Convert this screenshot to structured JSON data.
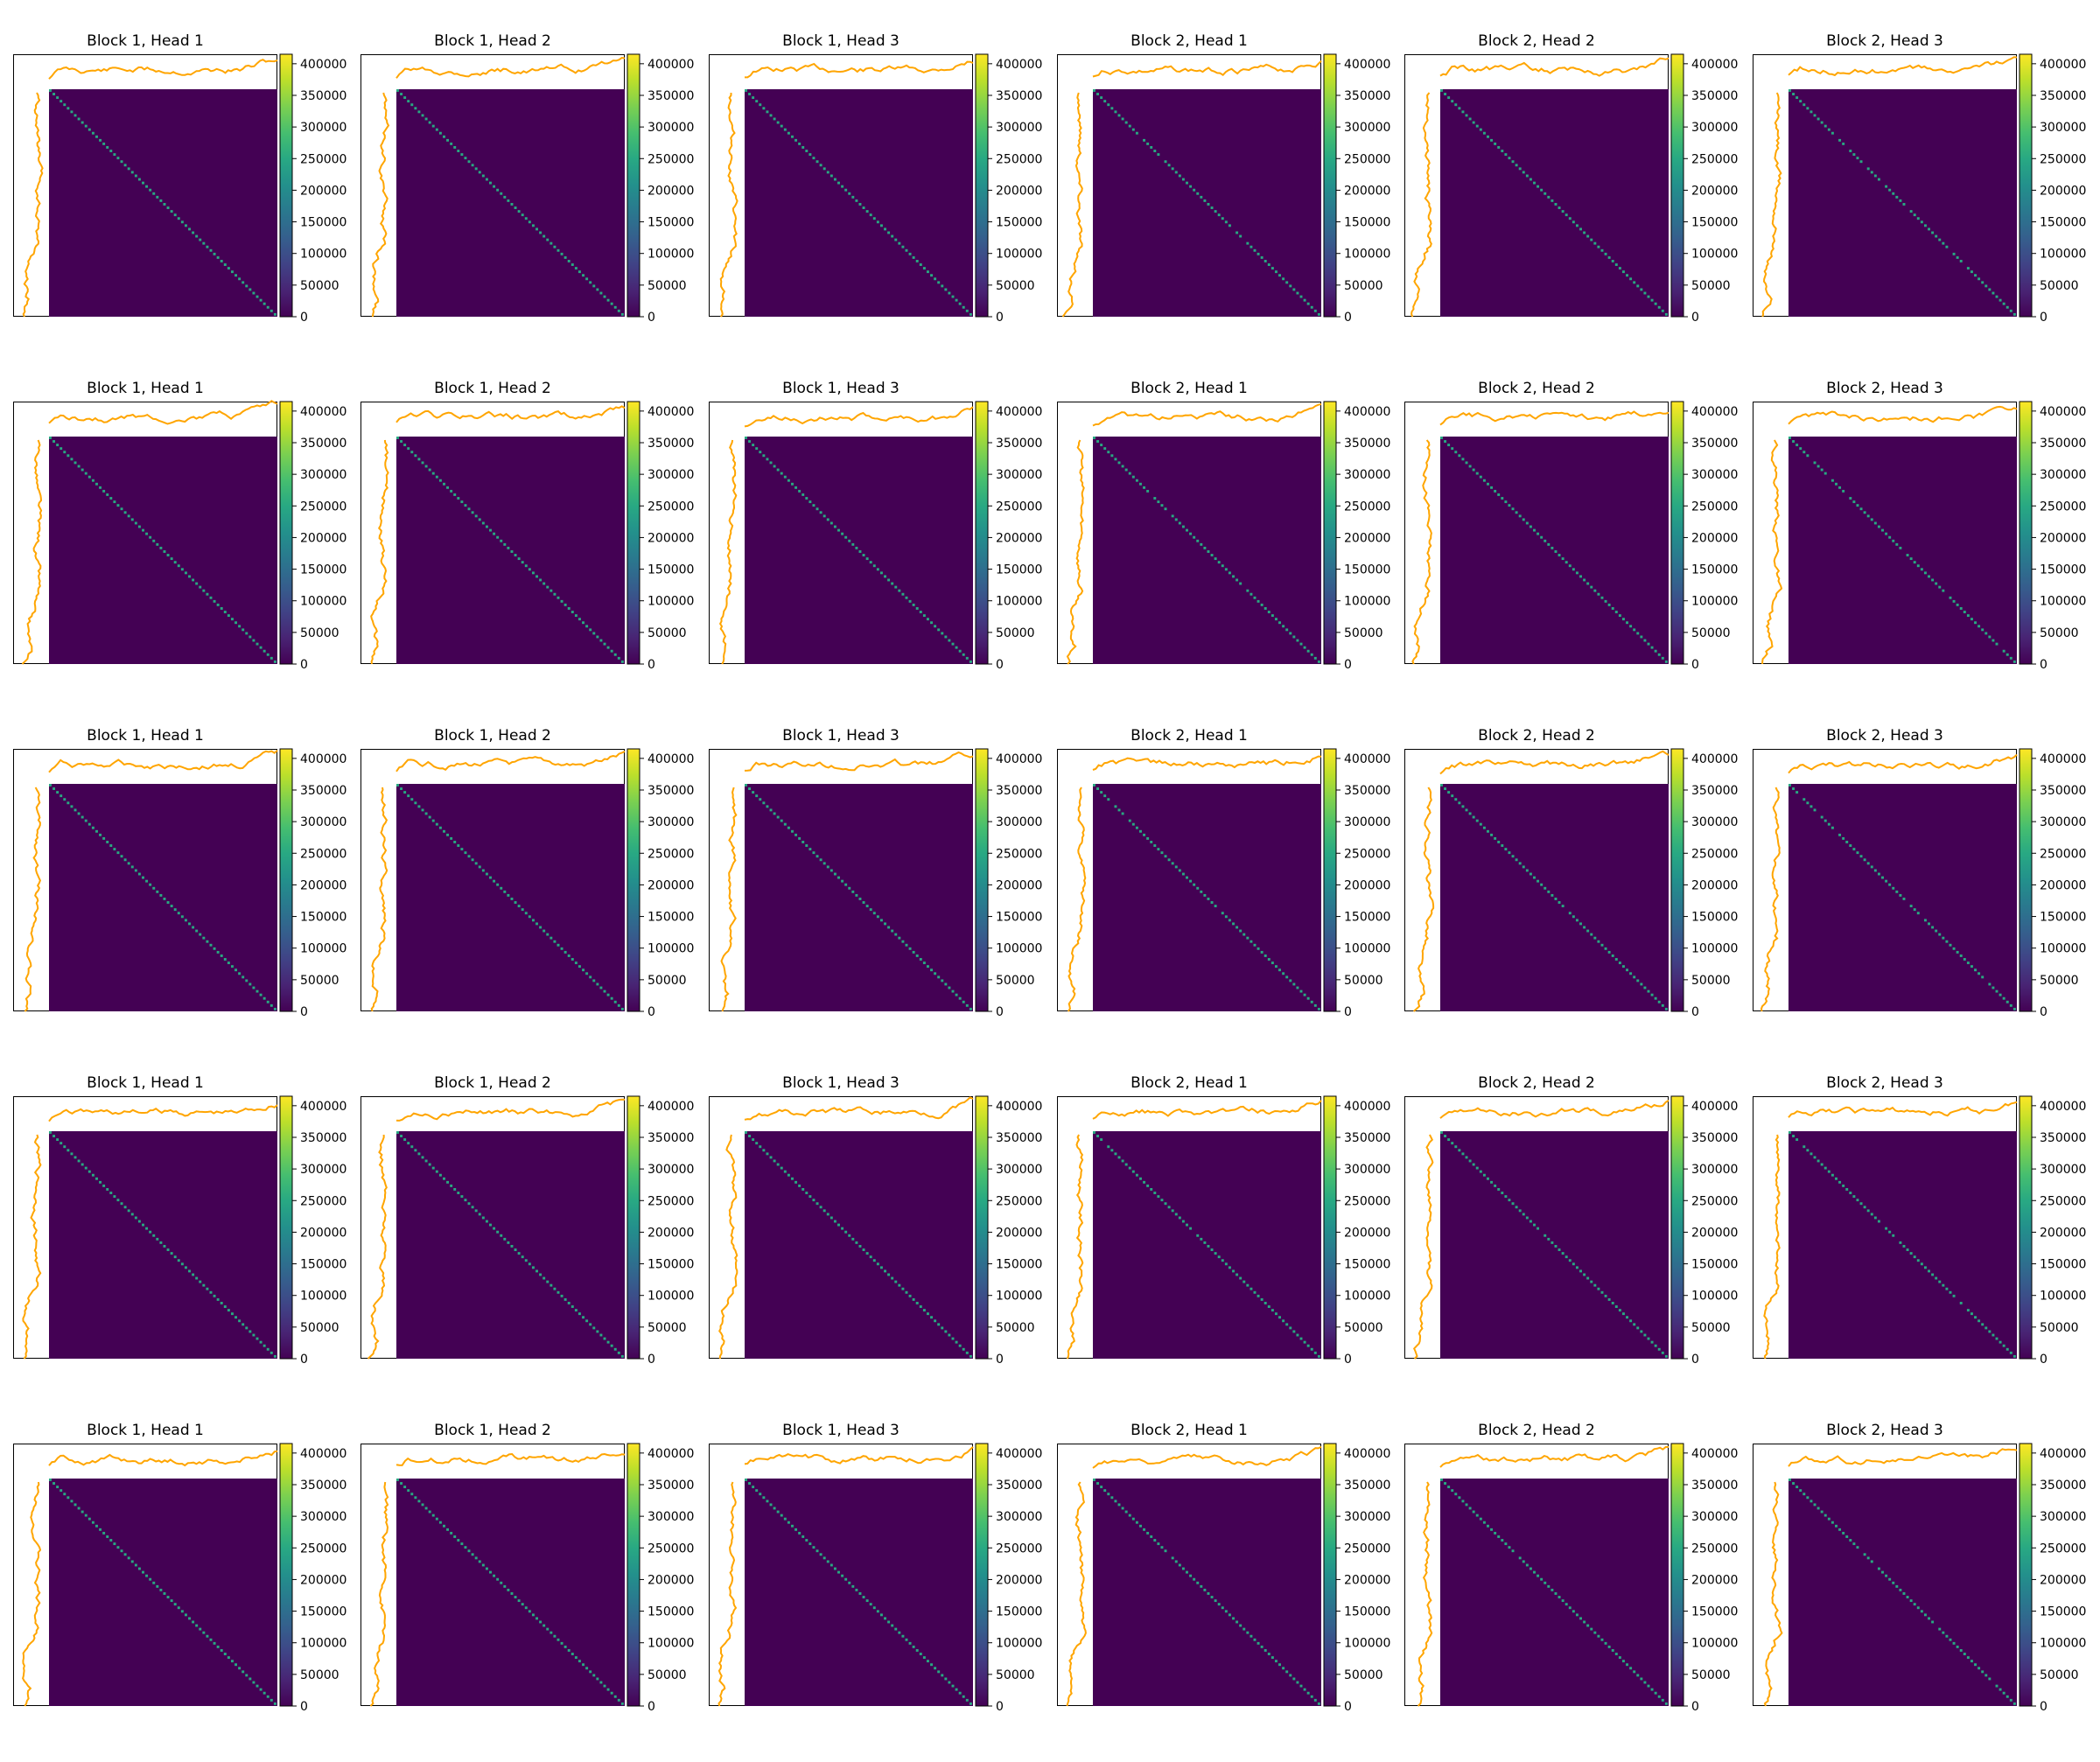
{
  "chart_data": {
    "type": "heatmap",
    "layout": {
      "rows": 5,
      "cols": 6
    },
    "titles": [
      "Block 1, Head 1",
      "Block 1, Head 2",
      "Block 1, Head 3",
      "Block 2, Head 1",
      "Block 2, Head 2",
      "Block 2, Head 3"
    ],
    "colorbar": {
      "colormap": "viridis",
      "vmin": 0,
      "vmax": 415000,
      "ticks": [
        0,
        50000,
        100000,
        150000,
        200000,
        250000,
        300000,
        350000,
        400000
      ],
      "tick_labels": [
        "0",
        "50000",
        "100000",
        "150000",
        "200000",
        "250000",
        "300000",
        "350000",
        "400000"
      ]
    },
    "matrix_size": 64,
    "diagonal_value": 250000,
    "off_diagonal_value": 0,
    "marginal_line_color": "#ffa500",
    "panels": [
      {
        "row": 0,
        "col": 0,
        "title_index": 0,
        "seed": 11,
        "gaps": []
      },
      {
        "row": 0,
        "col": 1,
        "title_index": 1,
        "seed": 12,
        "gaps": []
      },
      {
        "row": 0,
        "col": 2,
        "title_index": 2,
        "seed": 13,
        "gaps": []
      },
      {
        "row": 0,
        "col": 3,
        "title_index": 3,
        "seed": 14,
        "gaps": [
          0.21,
          0.3,
          0.62,
          0.67
        ]
      },
      {
        "row": 0,
        "col": 4,
        "title_index": 4,
        "seed": 15,
        "gaps": []
      },
      {
        "row": 0,
        "col": 5,
        "title_index": 5,
        "seed": 16,
        "gaps": [
          0.2,
          0.25,
          0.34,
          0.42,
          0.52,
          0.72,
          0.77
        ]
      },
      {
        "row": 1,
        "col": 0,
        "title_index": 0,
        "seed": 21,
        "gaps": []
      },
      {
        "row": 1,
        "col": 1,
        "title_index": 1,
        "seed": 22,
        "gaps": []
      },
      {
        "row": 1,
        "col": 2,
        "title_index": 2,
        "seed": 23,
        "gaps": []
      },
      {
        "row": 1,
        "col": 3,
        "title_index": 3,
        "seed": 24,
        "gaps": [
          0.25,
          0.33,
          0.66
        ]
      },
      {
        "row": 1,
        "col": 4,
        "title_index": 4,
        "seed": 25,
        "gaps": []
      },
      {
        "row": 1,
        "col": 5,
        "title_index": 5,
        "seed": 26,
        "gaps": [
          0.1,
          0.18,
          0.26,
          0.5,
          0.7,
          0.93
        ]
      },
      {
        "row": 2,
        "col": 0,
        "title_index": 0,
        "seed": 31,
        "gaps": []
      },
      {
        "row": 2,
        "col": 1,
        "title_index": 1,
        "seed": 32,
        "gaps": []
      },
      {
        "row": 2,
        "col": 2,
        "title_index": 2,
        "seed": 33,
        "gaps": []
      },
      {
        "row": 2,
        "col": 3,
        "title_index": 3,
        "seed": 34,
        "gaps": [
          0.08,
          0.15,
          0.55
        ]
      },
      {
        "row": 2,
        "col": 4,
        "title_index": 4,
        "seed": 35,
        "gaps": [
          0.55
        ]
      },
      {
        "row": 2,
        "col": 5,
        "title_index": 5,
        "seed": 36,
        "gaps": [
          0.05,
          0.12,
          0.2,
          0.52,
          0.58,
          0.88
        ]
      },
      {
        "row": 3,
        "col": 0,
        "title_index": 0,
        "seed": 41,
        "gaps": []
      },
      {
        "row": 3,
        "col": 1,
        "title_index": 1,
        "seed": 42,
        "gaps": []
      },
      {
        "row": 3,
        "col": 2,
        "title_index": 2,
        "seed": 43,
        "gaps": []
      },
      {
        "row": 3,
        "col": 3,
        "title_index": 3,
        "seed": 44,
        "gaps": [
          0.05,
          0.45
        ]
      },
      {
        "row": 3,
        "col": 4,
        "title_index": 4,
        "seed": 45,
        "gaps": [
          0.45
        ]
      },
      {
        "row": 3,
        "col": 5,
        "title_index": 5,
        "seed": 46,
        "gaps": [
          0.05,
          0.42,
          0.47,
          0.74,
          0.78
        ]
      },
      {
        "row": 4,
        "col": 0,
        "title_index": 0,
        "seed": 51,
        "gaps": []
      },
      {
        "row": 4,
        "col": 1,
        "title_index": 1,
        "seed": 52,
        "gaps": []
      },
      {
        "row": 4,
        "col": 2,
        "title_index": 2,
        "seed": 53,
        "gaps": []
      },
      {
        "row": 4,
        "col": 3,
        "title_index": 3,
        "seed": 54,
        "gaps": [
          0.34
        ]
      },
      {
        "row": 4,
        "col": 4,
        "title_index": 4,
        "seed": 55,
        "gaps": [
          0.34
        ]
      },
      {
        "row": 4,
        "col": 5,
        "title_index": 5,
        "seed": 56,
        "gaps": [
          0.32,
          0.38,
          0.65,
          0.9
        ]
      }
    ]
  }
}
